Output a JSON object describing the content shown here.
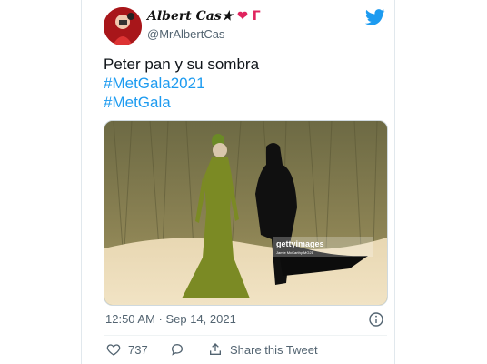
{
  "tweet": {
    "display_name": "Albert Cas",
    "name_emojis": {
      "star": "★",
      "heart": "❤",
      "flag": "Г"
    },
    "handle": "@MrAlbertCas",
    "text_line": "Peter pan y su sombra",
    "hashtags": [
      "#MetGala2021",
      "#MetGala"
    ],
    "timestamp": "12:50 AM · Sep 14, 2021",
    "media": {
      "watermark": "gettyimages",
      "credit": "Jamie McCarthy/MG21"
    },
    "actions": {
      "like_count": "737",
      "reply_label": "",
      "share_label": "Share this Tweet"
    }
  },
  "colors": {
    "link": "#1d9bf0",
    "twitter_blue": "#1d9bf0",
    "heart": "#e0245e",
    "secondary_text": "#536471"
  },
  "icons": [
    "twitter-bird-icon",
    "info-icon",
    "heart-icon",
    "reply-icon",
    "share-icon"
  ]
}
